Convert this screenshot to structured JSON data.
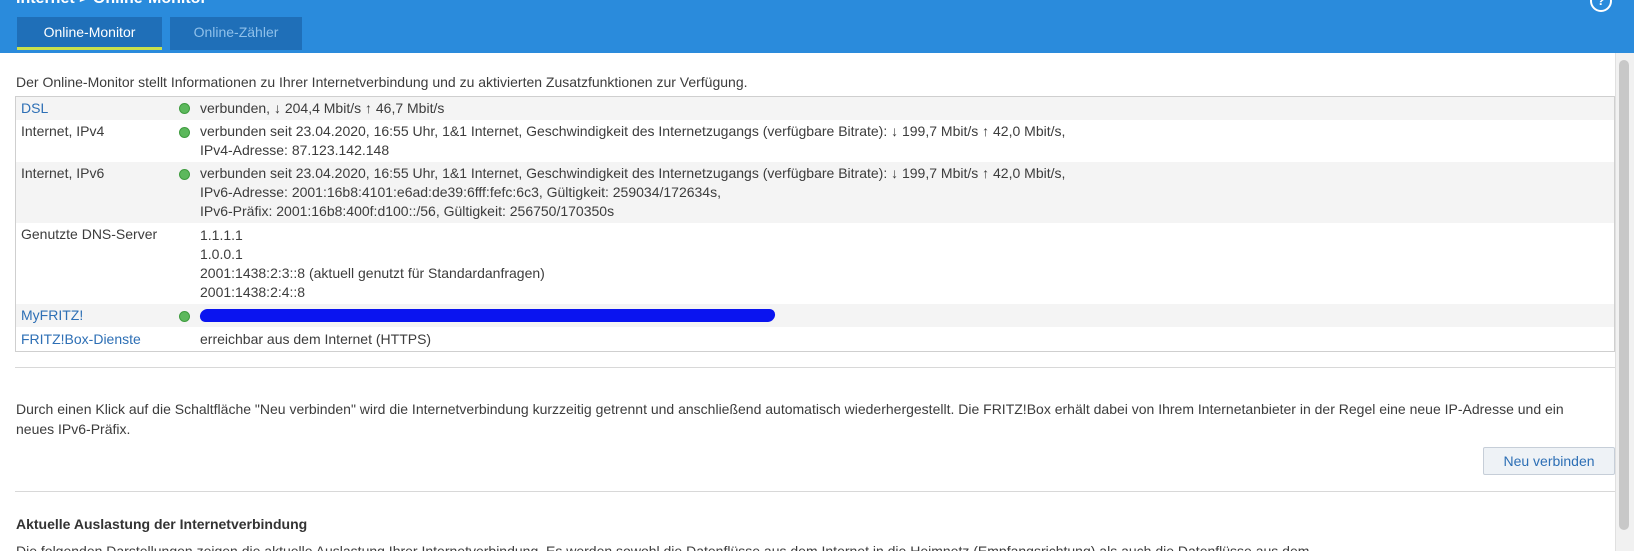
{
  "window": {
    "title": "Internet > Online-Monitor",
    "help_glyph": "?"
  },
  "tabs": [
    {
      "label": "Online-Monitor",
      "active": true
    },
    {
      "label": "Online-Zähler",
      "active": false
    }
  ],
  "intro_text": "Der Online-Monitor stellt Informationen zu Ihrer Internetverbindung und zu aktivierten Zusatzfunktionen zur Verfügung.",
  "status": {
    "dsl": {
      "label": "DSL",
      "value": "verbunden, ↓ 204,4 Mbit/s ↑ 46,7 Mbit/s"
    },
    "ipv4": {
      "label": "Internet, IPv4",
      "line1": "verbunden seit 23.04.2020, 16:55 Uhr, 1&1 Internet, Geschwindigkeit des Internetzugangs (verfügbare Bitrate): ↓ 199,7 Mbit/s ↑ 42,0 Mbit/s,",
      "line2": "IPv4-Adresse: 87.123.142.148"
    },
    "ipv6": {
      "label": "Internet, IPv6",
      "line1": "verbunden seit 23.04.2020, 16:55 Uhr, 1&1 Internet, Geschwindigkeit des Internetzugangs (verfügbare Bitrate): ↓ 199,7 Mbit/s ↑ 42,0 Mbit/s,",
      "line2": "IPv6-Adresse: 2001:16b8:4101:e6ad:de39:6fff:fefc:6c3, Gültigkeit: 259034/172634s,",
      "line3": "IPv6-Präfix: 2001:16b8:400f:d100::/56, Gültigkeit: 256750/170350s"
    },
    "dns": {
      "label": "Genutzte DNS-Server",
      "servers": [
        "1.1.1.1",
        "1.0.0.1",
        "2001:1438:2:3::8 (aktuell genutzt für Standardanfragen)",
        "2001:1438:2:4::8"
      ]
    },
    "myfritz": {
      "label": "MyFRITZ!"
    },
    "fritzbox_dienste": {
      "label": "FRITZ!Box-Dienste",
      "value": "erreichbar aus dem Internet (HTTPS)"
    }
  },
  "reconnect": {
    "text": "Durch einen Klick auf die Schaltfläche \"Neu verbinden\" wird die Internetverbindung kurzzeitig getrennt und anschließend automatisch wiederhergestellt. Die FRITZ!Box erhält dabei von Ihrem Internetanbieter in der Regel eine neue IP-Adresse und ein neues IPv6-Präfix.",
    "button_label": "Neu verbinden"
  },
  "load_section": {
    "heading": "Aktuelle Auslastung der Internetverbindung",
    "description_fragment": "Die folgenden Darstellungen zeigen die aktuelle Auslastung Ihrer Internetverbindung. Es werden sowohl die Datenflüsse aus dem Internet in die Heimnetz (Empfangsrichtung) als auch die Datenflüsse aus dem"
  },
  "colors": {
    "header_blue": "#2a8bdc",
    "tab_blue": "#1f6fb8",
    "tab_active_underline": "#c8e04c",
    "status_ok_green": "#5cb85c",
    "link_blue": "#2d6fb5",
    "redaction_blue": "#0a14f0"
  },
  "icons": {
    "status_dot": "status-ok-icon",
    "help": "help-icon"
  }
}
